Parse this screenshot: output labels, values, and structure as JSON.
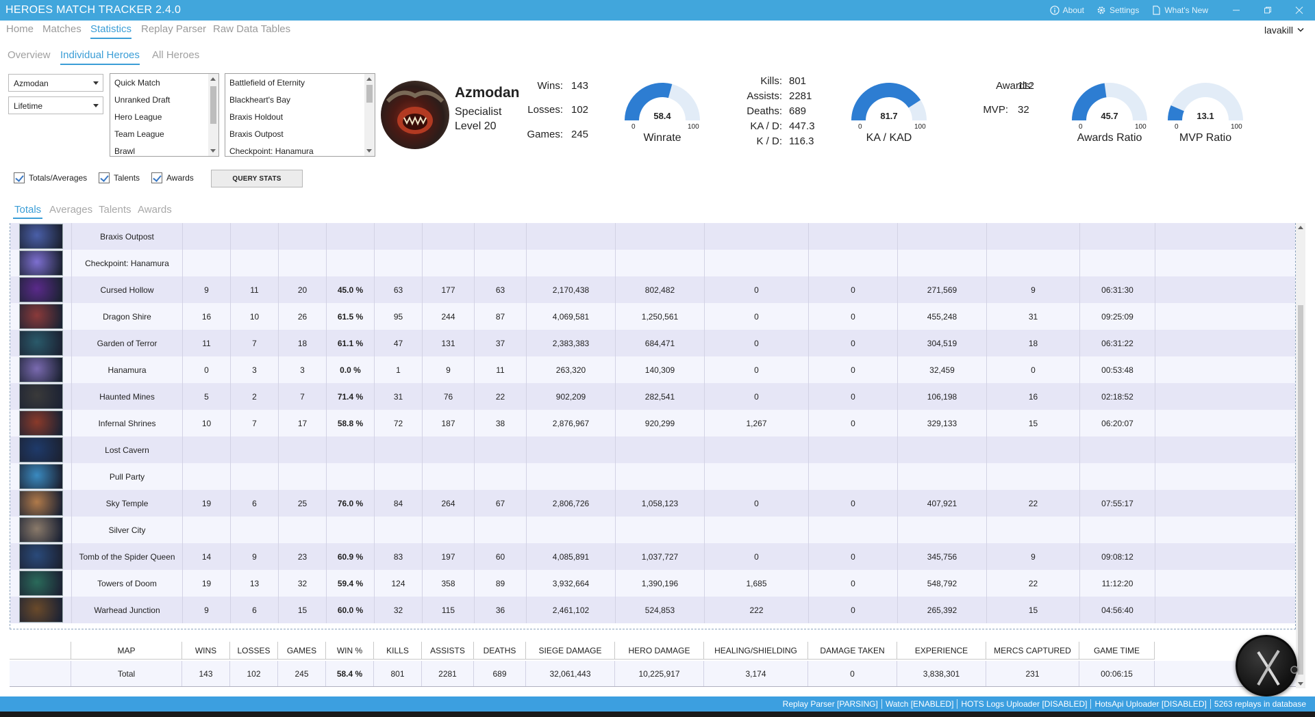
{
  "app": {
    "title": "HEROES MATCH TRACKER 2.4.0",
    "about": "About",
    "settings": "Settings",
    "whats_new": "What's New"
  },
  "nav": {
    "tabs": [
      "Home",
      "Matches",
      "Statistics",
      "Replay Parser",
      "Raw Data Tables"
    ],
    "active": "Statistics",
    "user": "lavakill"
  },
  "subnav": {
    "tabs": [
      "Overview",
      "Individual Heroes",
      "All Heroes"
    ],
    "active": "Individual Heroes"
  },
  "filters": {
    "hero": "Azmodan",
    "season": "Lifetime",
    "game_modes": [
      "Quick Match",
      "Unranked Draft",
      "Hero League",
      "Team League",
      "Brawl"
    ],
    "maps": [
      "Battlefield of Eternity",
      "Blackheart's Bay",
      "Braxis Holdout",
      "Braxis Outpost",
      "Checkpoint: Hanamura"
    ]
  },
  "hero": {
    "name": "Azmodan",
    "role": "Specialist",
    "level": "Level 20"
  },
  "summary": {
    "wins_label": "Wins:",
    "wins": "143",
    "losses_label": "Losses:",
    "losses": "102",
    "games_label": "Games:",
    "games": "245",
    "kills_label": "Kills:",
    "kills": "801",
    "assists_label": "Assists:",
    "assists": "2281",
    "deaths_label": "Deaths:",
    "deaths": "689",
    "kad_label": "KA / D:",
    "kad": "447.3",
    "kd_label": "K / D:",
    "kd": "116.3",
    "awards_label": "Awards:",
    "awards": "112",
    "mvp_label": "MVP:",
    "mvp": "32"
  },
  "gauges": [
    {
      "title": "Winrate",
      "value": 58.4,
      "display": "58.4",
      "min": "0",
      "max": "100"
    },
    {
      "title": "KA / KAD",
      "value": 81.7,
      "display": "81.7",
      "min": "0",
      "max": "100"
    },
    {
      "title": "Awards Ratio",
      "value": 45.7,
      "display": "45.7",
      "min": "0",
      "max": "100"
    },
    {
      "title": "MVP Ratio",
      "value": 13.1,
      "display": "13.1",
      "min": "0",
      "max": "100"
    }
  ],
  "options": {
    "totals_averages": "Totals/Averages",
    "talents": "Talents",
    "awards": "Awards",
    "query_button": "QUERY STATS"
  },
  "table_tabs": [
    "Totals",
    "Averages",
    "Talents",
    "Awards"
  ],
  "table_tabs_active": "Totals",
  "columns": [
    "MAP",
    "WINS",
    "LOSSES",
    "GAMES",
    "WIN %",
    "KILLS",
    "ASSISTS",
    "DEATHS",
    "SIEGE DAMAGE",
    "HERO DAMAGE",
    "HEALING/SHIELDING",
    "DAMAGE TAKEN",
    "EXPERIENCE",
    "MERCS CAPTURED",
    "GAME TIME"
  ],
  "rows": [
    {
      "map": "Braxis Outpost",
      "color": "#4a5fa8",
      "vals": [
        "",
        "",
        "",
        "",
        "",
        "",
        "",
        "",
        "",
        "",
        "",
        "",
        "",
        ""
      ]
    },
    {
      "map": "Checkpoint: Hanamura",
      "color": "#7d6fd0",
      "vals": [
        "",
        "",
        "",
        "",
        "",
        "",
        "",
        "",
        "",
        "",
        "",
        "",
        "",
        ""
      ]
    },
    {
      "map": "Cursed Hollow",
      "color": "#5a2a8a",
      "vals": [
        "9",
        "11",
        "20",
        "45.0 %",
        "63",
        "177",
        "63",
        "2,170,438",
        "802,482",
        "0",
        "0",
        "271,569",
        "9",
        "06:31:30"
      ]
    },
    {
      "map": "Dragon Shire",
      "color": "#8a3a3a",
      "vals": [
        "16",
        "10",
        "26",
        "61.5 %",
        "95",
        "244",
        "87",
        "4,069,581",
        "1,250,561",
        "0",
        "0",
        "455,248",
        "31",
        "09:25:09"
      ]
    },
    {
      "map": "Garden of Terror",
      "color": "#2a5a6a",
      "vals": [
        "11",
        "7",
        "18",
        "61.1 %",
        "47",
        "131",
        "37",
        "2,383,383",
        "684,471",
        "0",
        "0",
        "304,519",
        "18",
        "06:31:22"
      ]
    },
    {
      "map": "Hanamura",
      "color": "#7a6ab0",
      "vals": [
        "0",
        "3",
        "3",
        "0.0 %",
        "1",
        "9",
        "11",
        "263,320",
        "140,309",
        "0",
        "0",
        "32,459",
        "0",
        "00:53:48"
      ]
    },
    {
      "map": "Haunted Mines",
      "color": "#3a3a3a",
      "vals": [
        "5",
        "2",
        "7",
        "71.4 %",
        "31",
        "76",
        "22",
        "902,209",
        "282,541",
        "0",
        "0",
        "106,198",
        "16",
        "02:18:52"
      ]
    },
    {
      "map": "Infernal Shrines",
      "color": "#8a3a2a",
      "vals": [
        "10",
        "7",
        "17",
        "58.8 %",
        "72",
        "187",
        "38",
        "2,876,967",
        "920,299",
        "1,267",
        "0",
        "329,133",
        "15",
        "06:20:07"
      ]
    },
    {
      "map": "Lost Cavern",
      "color": "#1e3a6a",
      "vals": [
        "",
        "",
        "",
        "",
        "",
        "",
        "",
        "",
        "",
        "",
        "",
        "",
        "",
        ""
      ]
    },
    {
      "map": "Pull Party",
      "color": "#3a8ac0",
      "vals": [
        "",
        "",
        "",
        "",
        "",
        "",
        "",
        "",
        "",
        "",
        "",
        "",
        "",
        ""
      ]
    },
    {
      "map": "Sky Temple",
      "color": "#b07a4a",
      "vals": [
        "19",
        "6",
        "25",
        "76.0 %",
        "84",
        "264",
        "67",
        "2,806,726",
        "1,058,123",
        "0",
        "0",
        "407,921",
        "22",
        "07:55:17"
      ]
    },
    {
      "map": "Silver City",
      "color": "#8a7a6a",
      "vals": [
        "",
        "",
        "",
        "",
        "",
        "",
        "",
        "",
        "",
        "",
        "",
        "",
        "",
        ""
      ]
    },
    {
      "map": "Tomb of the Spider Queen",
      "color": "#2a4a7a",
      "vals": [
        "14",
        "9",
        "23",
        "60.9 %",
        "83",
        "197",
        "60",
        "4,085,891",
        "1,037,727",
        "0",
        "0",
        "345,756",
        "9",
        "09:08:12"
      ]
    },
    {
      "map": "Towers of Doom",
      "color": "#2a6a5a",
      "vals": [
        "19",
        "13",
        "32",
        "59.4 %",
        "124",
        "358",
        "89",
        "3,932,664",
        "1,390,196",
        "1,685",
        "0",
        "548,792",
        "22",
        "11:12:20"
      ]
    },
    {
      "map": "Warhead Junction",
      "color": "#6a4a2a",
      "vals": [
        "9",
        "6",
        "15",
        "60.0 %",
        "32",
        "115",
        "36",
        "2,461,102",
        "524,853",
        "222",
        "0",
        "265,392",
        "15",
        "04:56:40"
      ]
    }
  ],
  "total": {
    "label": "Total",
    "vals": [
      "143",
      "102",
      "245",
      "58.4 %",
      "801",
      "2281",
      "689",
      "32,061,443",
      "10,225,917",
      "3,174",
      "0",
      "3,838,301",
      "231",
      "00:06:15"
    ]
  },
  "status": [
    "Replay Parser [PARSING]",
    "Watch [ENABLED]",
    "HOTS Logs Uploader [DISABLED]",
    "HotsApi Uploader [DISABLED]",
    "5263  replays in database"
  ],
  "colors": {
    "accent": "#41a6dc",
    "gauge_fill": "#2d7dd2",
    "gauge_bg": "#e2ecf7"
  }
}
